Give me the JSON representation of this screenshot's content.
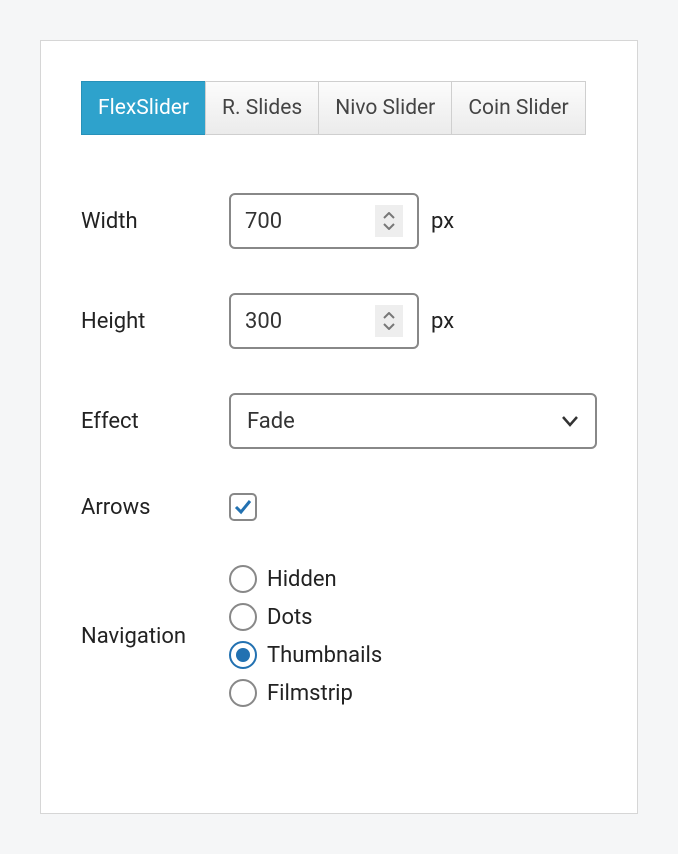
{
  "tabs": [
    {
      "label": "FlexSlider",
      "active": true
    },
    {
      "label": "R. Slides",
      "active": false
    },
    {
      "label": "Nivo Slider",
      "active": false
    },
    {
      "label": "Coin Slider",
      "active": false
    }
  ],
  "form": {
    "width": {
      "label": "Width",
      "value": "700",
      "unit": "px"
    },
    "height": {
      "label": "Height",
      "value": "300",
      "unit": "px"
    },
    "effect": {
      "label": "Effect",
      "value": "Fade"
    },
    "arrows": {
      "label": "Arrows",
      "checked": true
    },
    "navigation": {
      "label": "Navigation",
      "options": [
        {
          "label": "Hidden",
          "selected": false
        },
        {
          "label": "Dots",
          "selected": false
        },
        {
          "label": "Thumbnails",
          "selected": true
        },
        {
          "label": "Filmstrip",
          "selected": false
        }
      ]
    }
  }
}
